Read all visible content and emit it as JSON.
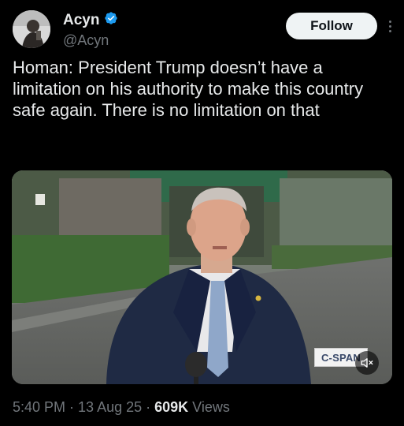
{
  "author": {
    "name": "Acyn",
    "handle": "@Acyn"
  },
  "follow_label": "Follow",
  "tweet_text": "Homan: President Trump doesn’t have a limitation on his authority to make this country safe again. There is no limitation on that",
  "media": {
    "watermark": "C-SPAN",
    "audio_state": "muted"
  },
  "meta": {
    "time": "5:40 PM",
    "separator": "·",
    "date": "13 Aug 25",
    "views_count": "609K",
    "views_label": "Views"
  },
  "colors": {
    "background": "#000000",
    "text_primary": "#e7e9ea",
    "text_secondary": "#71767b",
    "verified_blue": "#1d9bf0"
  }
}
